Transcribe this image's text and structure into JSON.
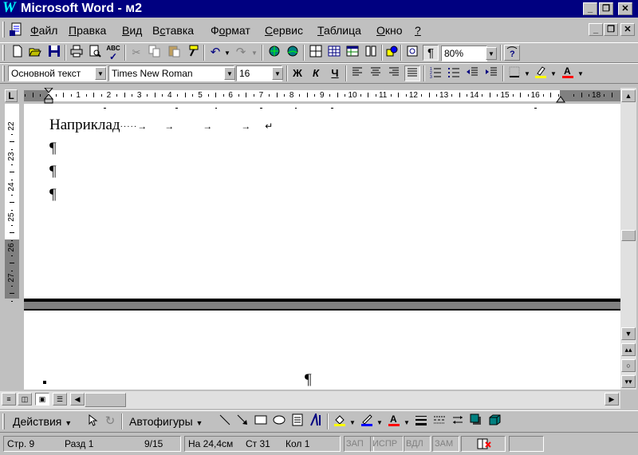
{
  "window": {
    "title": "Microsoft Word - м2",
    "logo_letter": "W"
  },
  "title_buttons": {
    "minimize": "_",
    "restore": "▫",
    "close": "✕"
  },
  "menu": [
    "Файл",
    "Правка",
    "Вид",
    "Вставка",
    "Формат",
    "Сервис",
    "Таблица",
    "Окно",
    "?"
  ],
  "menu_access_keys": [
    "Ф",
    "П",
    "В",
    "с",
    "о",
    "С",
    "Т",
    "О",
    "?"
  ],
  "standard_toolbar": {
    "icons": [
      "new-icon",
      "open-icon",
      "save-icon",
      "print-icon",
      "print-preview-icon",
      "spelling-icon",
      "cut-icon",
      "copy-icon",
      "paste-icon",
      "format-painter-icon",
      "undo-icon",
      "redo-icon",
      "insert-hyperlink-icon",
      "web-toolbar-icon",
      "tables-borders-icon",
      "insert-table-icon",
      "insert-excel-icon",
      "columns-icon",
      "drawing-icon",
      "document-map-icon",
      "show-hide-icon",
      "help-icon"
    ],
    "zoom": "80%"
  },
  "formatting_toolbar": {
    "style": "Основной текст",
    "font": "Times New Roman",
    "size": "16",
    "bold": "Ж",
    "italic": "К",
    "underline": "Ч"
  },
  "ruler": {
    "tab_selector": "L",
    "numbers": [
      "1",
      "2",
      "3",
      "4",
      "5",
      "6",
      "7",
      "8",
      "9",
      "10",
      "11",
      "12",
      "13",
      "14",
      "15",
      "16",
      "17",
      "18"
    ],
    "vertical_numbers": [
      "22",
      "23",
      "24",
      "25",
      "26",
      "27"
    ]
  },
  "document": {
    "line1": "Наприклад",
    "pilcrow": "¶"
  },
  "drawing_toolbar": {
    "actions": "Действия",
    "autoshapes": "Автофигуры"
  },
  "status": {
    "page": "Стр. 9",
    "section": "Разд 1",
    "pages": "9/15",
    "at": "На 24,4см",
    "line": "Ст 31",
    "col": "Кол 1",
    "rec": "ЗАП",
    "trk": "ИСПР",
    "ext": "ВДЛ",
    "ovr": "ЗАМ"
  }
}
